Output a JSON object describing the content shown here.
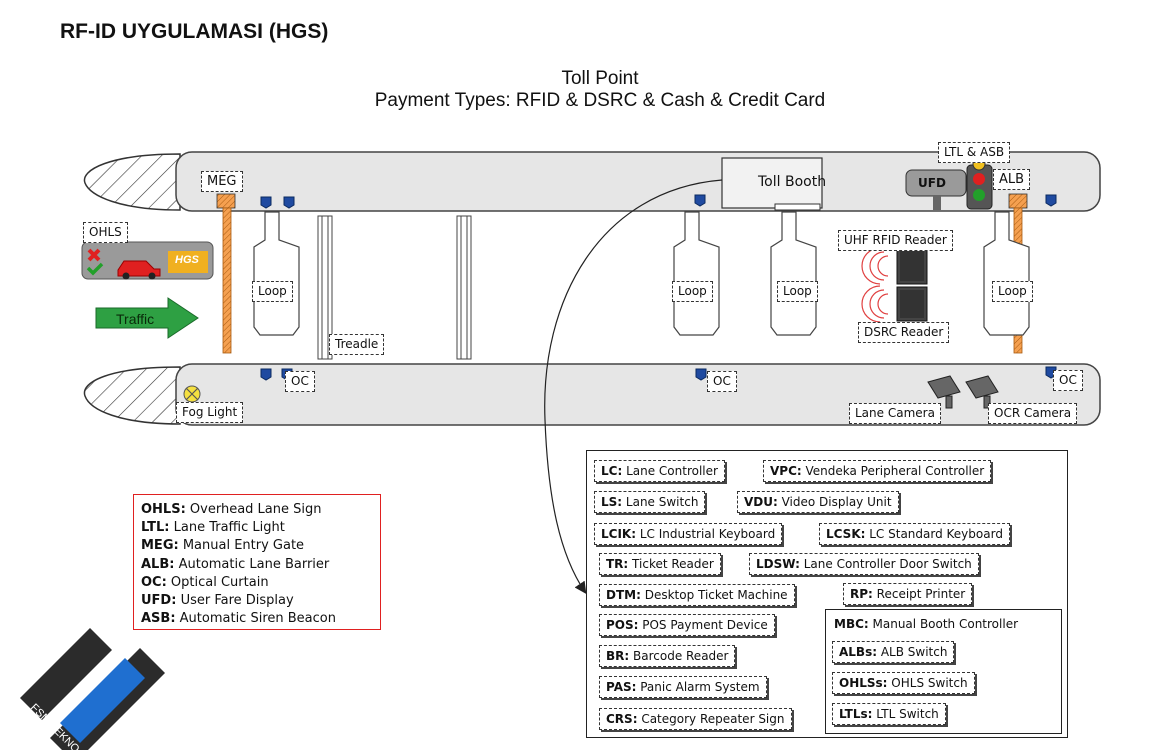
{
  "page": {
    "title": "RF-ID UYGULAMASI (HGS)"
  },
  "diagram": {
    "title_line1": "Toll Point",
    "title_line2": "Payment Types: RFID & DSRC & Cash & Credit Card",
    "labels": {
      "meg": "MEG",
      "toll_booth": "Toll Booth",
      "ltl_asb": "LTL & ASB",
      "ufd": "UFD",
      "alb": "ALB",
      "ohls": "OHLS",
      "hgs_badge": "HGS",
      "traffic": "Traffic",
      "loop": "Loop",
      "treadle": "Treadle",
      "uhf_reader": "UHF RFID Reader",
      "dsrc_reader": "DSRC Reader",
      "oc": "OC",
      "fog_light": "Fog Light",
      "lane_camera": "Lane Camera",
      "ocr_camera": "OCR Camera"
    },
    "colors": {
      "barrier": "#f08a2a",
      "traffic_arrow": "#2ea043",
      "marker": "#1f4aa0",
      "light_red": "#e02020",
      "light_green": "#22a02a",
      "light_amber": "#f0c020"
    }
  },
  "definitions": [
    {
      "abbr": "OHLS:",
      "text": " Overhead Lane Sign"
    },
    {
      "abbr": "LTL:",
      "text": " Lane Traffic Light"
    },
    {
      "abbr": "MEG:",
      "text": " Manual Entry Gate"
    },
    {
      "abbr": "ALB:",
      "text": " Automatic Lane Barrier"
    },
    {
      "abbr": "OC:",
      "text": " Optical Curtain"
    },
    {
      "abbr": "UFD:",
      "text": " User Fare Display"
    },
    {
      "abbr": "ASB:",
      "text": " Automatic Siren Beacon"
    }
  ],
  "devices": {
    "lc": {
      "abbr": "LC:",
      "text": " Lane Controller"
    },
    "vpc": {
      "abbr": "VPC:",
      "text": " Vendeka Peripheral Controller"
    },
    "ls": {
      "abbr": "LS:",
      "text": " Lane Switch"
    },
    "vdu": {
      "abbr": "VDU:",
      "text": " Video Display Unit"
    },
    "lcik": {
      "abbr": "LCIK:",
      "text": " LC Industrial Keyboard"
    },
    "lcsk": {
      "abbr": "LCSK:",
      "text": " LC Standard Keyboard"
    },
    "tr": {
      "abbr": "TR:",
      "text": " Ticket Reader"
    },
    "ldsw": {
      "abbr": "LDSW:",
      "text": " Lane Controller Door Switch"
    },
    "dtm": {
      "abbr": "DTM:",
      "text": " Desktop Ticket Machine"
    },
    "rp": {
      "abbr": "RP:",
      "text": " Receipt Printer"
    },
    "pos": {
      "abbr": "POS:",
      "text": " POS Payment Device"
    },
    "br": {
      "abbr": "BR:",
      "text": " Barcode Reader"
    },
    "pas": {
      "abbr": "PAS:",
      "text": " Panic Alarm System"
    },
    "crs": {
      "abbr": "CRS:",
      "text": " Category Repeater Sign"
    },
    "mbc": {
      "abbr": "MBC:",
      "text": " Manual Booth Controller"
    },
    "albs": {
      "abbr": "ALBs:",
      "text": " ALB Switch"
    },
    "ohlss": {
      "abbr": "OHLSs:",
      "text": " OHLS Switch"
    },
    "ltls": {
      "abbr": "LTLs:",
      "text": " LTL Switch"
    }
  },
  "logo": {
    "text": "FSM TEKNO",
    "colors": {
      "dark": "#2b2b2b",
      "blue": "#1f6fd0"
    }
  }
}
